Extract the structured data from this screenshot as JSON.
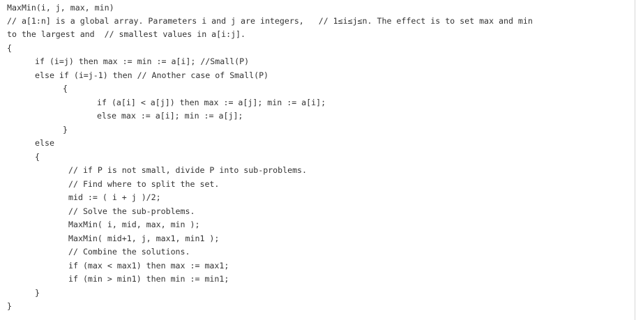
{
  "code": {
    "lines": [
      "MaxMin(i, j, max, min)",
      "// a[1:n] is a global array. Parameters i and j are integers,   // 1≤i≤j≤n. The effect is to set max and min",
      "to the largest and  // smallest values in a[i:j].",
      "{",
      "if (i=j) then max := min := a[i]; //Small(P)",
      "else if (i=j-1) then // Another case of Small(P)",
      "{",
      "if (a[i] < a[j]) then max := a[j]; min := a[i];",
      "else max := a[i]; min := a[j];",
      "}",
      "else",
      "{",
      "// if P is not small, divide P into sub-problems.",
      "// Find where to split the set.",
      "mid := ( i + j )/2;",
      "// Solve the sub-problems.",
      "MaxMin( i, mid, max, min );",
      "MaxMin( mid+1, j, max1, min1 );",
      "// Combine the solutions.",
      "if (max < max1) then max := max1;",
      "if (min > min1) then min := min1;",
      "}",
      "}"
    ]
  }
}
